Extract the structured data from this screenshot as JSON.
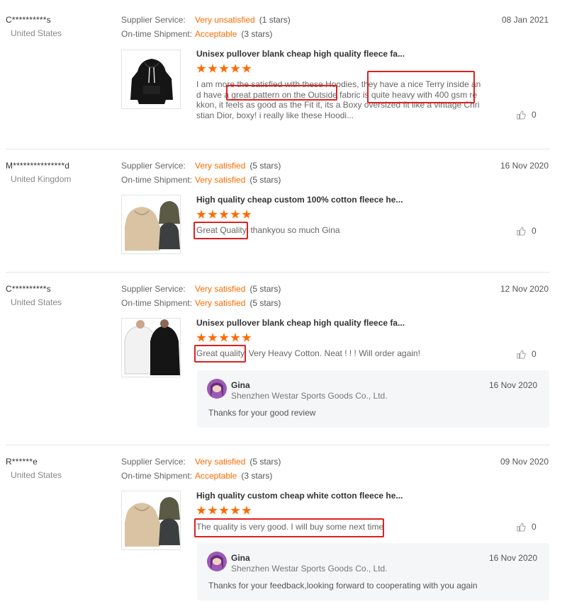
{
  "labels": {
    "supplier_service": "Supplier Service:",
    "on_time_shipment": "On-time Shipment:"
  },
  "colors": {
    "accent": "#ff6a00",
    "highlight": "#e02020",
    "reply_bg": "#f5f6f7"
  },
  "icons": {
    "like": "thumbs-up-icon",
    "star": "star-icon"
  },
  "reviews": [
    {
      "buyer": "C**********s",
      "country": "United States",
      "supplier_rating": "Very unsatisfied",
      "supplier_stars": "(1 stars)",
      "shipment_rating": "Acceptable",
      "shipment_stars": "(3 stars)",
      "date": "08 Jan 2021",
      "product_title": "Unisex pullover blank cheap high quality fleece fa...",
      "stars": 5,
      "text": "I am more the satisfied with these Hoodies, they have a nice Terry inside and have a great pattern on the Outside fabric is quite heavy with 400 gsm  rekkon, it feels as good as the Fit it, its a Boxy oversized fit like a vintage Christian Dior, boxy! i really like these Hoodi...",
      "likes": "0"
    },
    {
      "buyer": "M***************d",
      "country": "United Kingdom",
      "supplier_rating": "Very satisfied",
      "supplier_stars": "(5 stars)",
      "shipment_rating": "Very satisfied",
      "shipment_stars": "(5 stars)",
      "date": "16 Nov 2020",
      "product_title": "High quality cheap custom 100% cotton fleece he...",
      "stars": 5,
      "text": "Great Quality, thankyou so much Gina",
      "likes": "0"
    },
    {
      "buyer": "C**********s",
      "country": "United States",
      "supplier_rating": "Very satisfied",
      "supplier_stars": "(5 stars)",
      "shipment_rating": "Very satisfied",
      "shipment_stars": "(5 stars)",
      "date": "12 Nov 2020",
      "product_title": "Unisex pullover blank cheap high quality fleece fa...",
      "stars": 5,
      "text": "Great quality. Very Heavy Cotton. Neat ! ! ! Will order again!",
      "likes": "0",
      "reply": {
        "name": "Gina",
        "company": "Shenzhen Westar Sports Goods Co., Ltd.",
        "date": "16 Nov 2020",
        "text": "Thanks for your good review"
      }
    },
    {
      "buyer": "R******e",
      "country": "United States",
      "supplier_rating": "Very satisfied",
      "supplier_stars": "(5 stars)",
      "shipment_rating": "Acceptable",
      "shipment_stars": "(3 stars)",
      "date": "09 Nov 2020",
      "product_title": "High quality custom cheap white cotton fleece he...",
      "stars": 5,
      "text": "The quality is very good. I will buy some next time",
      "likes": "0",
      "reply": {
        "name": "Gina",
        "company": "Shenzhen Westar Sports Goods Co., Ltd.",
        "date": "16 Nov 2020",
        "text": "Thanks for your feedback,looking forward to cooperating with you again"
      }
    }
  ]
}
